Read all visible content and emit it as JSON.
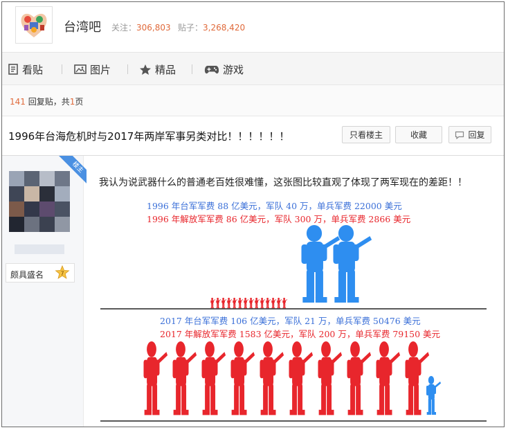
{
  "header": {
    "forum_name": "台湾吧",
    "followers_label": "关注：",
    "followers": "306,803",
    "posts_label": "贴子：",
    "posts": "3,268,420"
  },
  "nav": {
    "items": [
      {
        "label": "看贴",
        "icon": "document-icon"
      },
      {
        "label": "图片",
        "icon": "image-icon"
      },
      {
        "label": "精品",
        "icon": "star-icon"
      },
      {
        "label": "游戏",
        "icon": "gamepad-icon"
      }
    ]
  },
  "reply_bar": {
    "count": "141",
    "text1": " 回复贴，共",
    "pages": "1",
    "text2": "页"
  },
  "thread": {
    "title": "1996年台海危机时与2017年两岸军事另类对比！！！！！！",
    "buttons": {
      "only_op": "只看楼主",
      "favorite": "收藏",
      "reply": "回复"
    }
  },
  "post": {
    "corner_label": "楼主",
    "badge_text": "颇具盛名",
    "badge_level": "7",
    "text": "我认为说武器什么的普通老百姓很难懂，这张图比较直观了体现了两军现在的差距！！",
    "infographic": {
      "line1996_tw": "1996 年台军军费 88 亿美元，军队 40 万，单兵军费 22000 美元",
      "line1996_pla": "1996 年解放军军费 86 亿美元，军队 300 万，单兵军费 2866 美元",
      "line2017_tw": "2017 年台军军费 106 亿美元，军队 21 万，单兵军费 50476 美元",
      "line2017_pla": "2017 年解放军军费 1583 亿美元，军队 200 万，单兵军费 79150 美元"
    }
  },
  "colors": {
    "accent_orange": "#e06a3b",
    "blue": "#3a6fd8",
    "soldier_blue": "#2e8ef0",
    "red": "#e8262c"
  }
}
